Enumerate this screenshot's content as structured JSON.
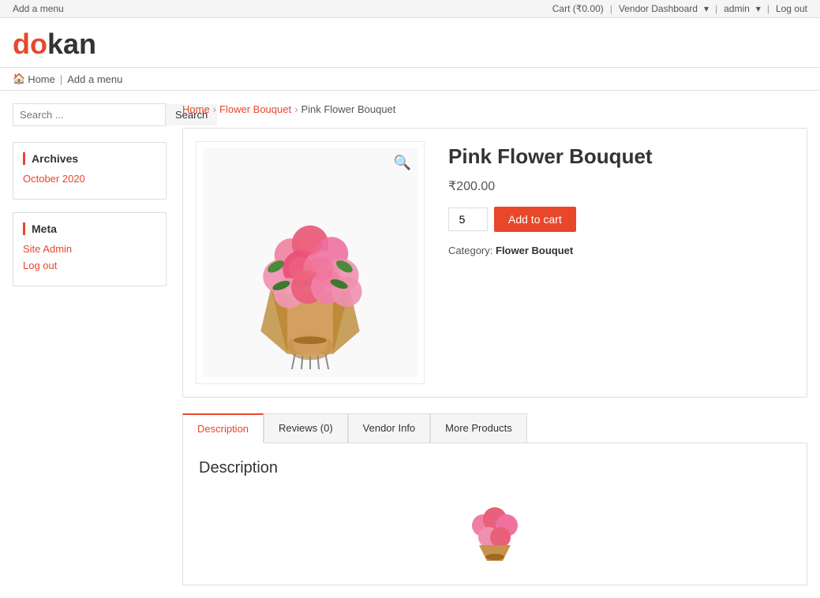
{
  "topbar": {
    "left": "Add a menu",
    "cart_label": "Cart (₹0.00)",
    "vendor_dashboard_label": "Vendor Dashboard",
    "admin_label": "admin",
    "logout_label": "Log out"
  },
  "header": {
    "logo_do": "do",
    "logo_kan": "kan"
  },
  "nav": {
    "home_label": "Home",
    "add_menu_label": "Add a menu"
  },
  "sidebar": {
    "search_placeholder": "Search ...",
    "search_button": "Search",
    "archives_title": "Archives",
    "archives_items": [
      {
        "label": "October 2020",
        "href": "#"
      }
    ],
    "meta_title": "Meta",
    "meta_items": [
      {
        "label": "Site Admin",
        "href": "#"
      },
      {
        "label": "Log out",
        "href": "#"
      }
    ]
  },
  "breadcrumb": {
    "home": "Home",
    "category": "Flower Bouquet",
    "current": "Pink Flower Bouquet"
  },
  "product": {
    "title": "Pink Flower Bouquet",
    "price": "₹200.00",
    "quantity": "5",
    "add_to_cart": "Add to cart",
    "category_label": "Category:",
    "category_value": "Flower Bouquet"
  },
  "tabs": {
    "items": [
      {
        "label": "Description",
        "active": true
      },
      {
        "label": "Reviews (0)",
        "active": false
      },
      {
        "label": "Vendor Info",
        "active": false
      },
      {
        "label": "More Products",
        "active": false
      }
    ],
    "description_title": "Description"
  }
}
